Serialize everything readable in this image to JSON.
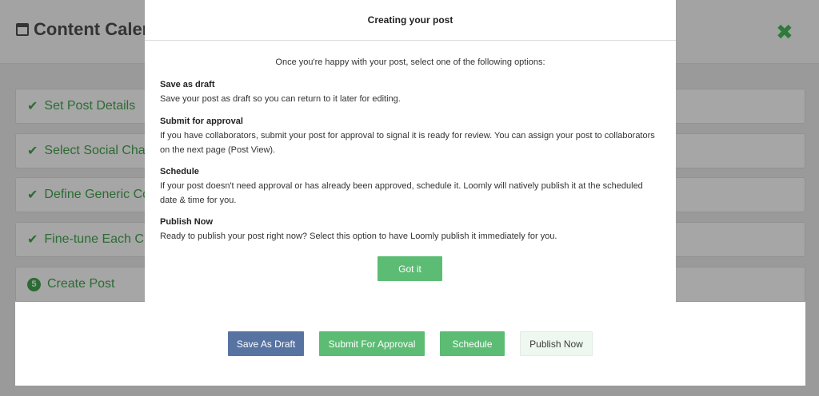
{
  "page": {
    "title": "Content Calend",
    "close_icon": "close-x-icon"
  },
  "steps": [
    {
      "label": "Set Post Details",
      "state": "done"
    },
    {
      "label": "Select Social Chan",
      "state": "done"
    },
    {
      "label": "Define Generic Co",
      "state": "done"
    },
    {
      "label": "Fine-tune Each Ch",
      "state": "done"
    },
    {
      "label": "Create Post",
      "state": "current",
      "number": "5"
    }
  ],
  "actions": {
    "save_draft": "Save As Draft",
    "submit_approval": "Submit For Approval",
    "schedule": "Schedule",
    "publish_now": "Publish Now"
  },
  "modal": {
    "title": "Creating your post",
    "intro": "Once you're happy with your post, select one of the following options:",
    "sections": [
      {
        "heading": "Save as draft",
        "text": "Save your post as draft so you can return to it later for editing."
      },
      {
        "heading": "Submit for approval",
        "text": "If you have collaborators, submit your post for approval to signal it is ready for review. You can assign your post to collaborators on the next page (Post View)."
      },
      {
        "heading": "Schedule",
        "text": "If your post doesn't need approval or has already been approved, schedule it. Loomly will natively publish it at the scheduled date & time for you."
      },
      {
        "heading": "Publish Now",
        "text": "Ready to publish your post right now? Select this option to have Loomly publish it immediately for you."
      }
    ],
    "got_it": "Got it"
  },
  "colors": {
    "accent_green": "#5cbc74",
    "draft_blue": "#5773a2",
    "step_green": "#2c6b33"
  }
}
